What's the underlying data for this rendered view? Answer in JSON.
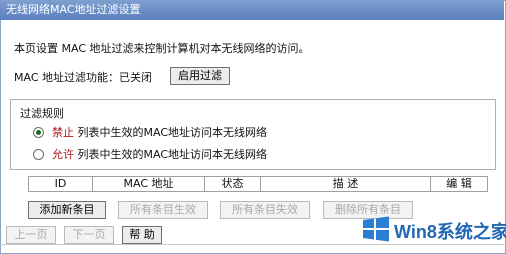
{
  "title": "无线网络MAC地址过滤设置",
  "description": "本页设置 MAC 地址过滤来控制计算机对本无线网络的访问。",
  "filter_status": {
    "label": "MAC 地址过滤功能：已关闭",
    "button": "启用过滤"
  },
  "rules": {
    "title": "过滤规则",
    "options": [
      {
        "keyword": "禁止",
        "text": "列表中生效的MAC地址访问本无线网络",
        "checked": true
      },
      {
        "keyword": "允许",
        "text": "列表中生效的MAC地址访问本无线网络",
        "checked": false
      }
    ]
  },
  "table": {
    "headers": [
      "ID",
      "MAC 地址",
      "状态",
      "描 述",
      "编 辑"
    ]
  },
  "actions": {
    "add_new": "添加新条目",
    "enable_all": "所有条目生效",
    "disable_all": "所有条目失效",
    "delete_all": "删除所有条目"
  },
  "nav": {
    "prev": "上一页",
    "next": "下一页",
    "help": "帮 助"
  },
  "watermark": {
    "text": "Win8系统之家",
    "colors": {
      "accent": "#2167b5"
    }
  }
}
